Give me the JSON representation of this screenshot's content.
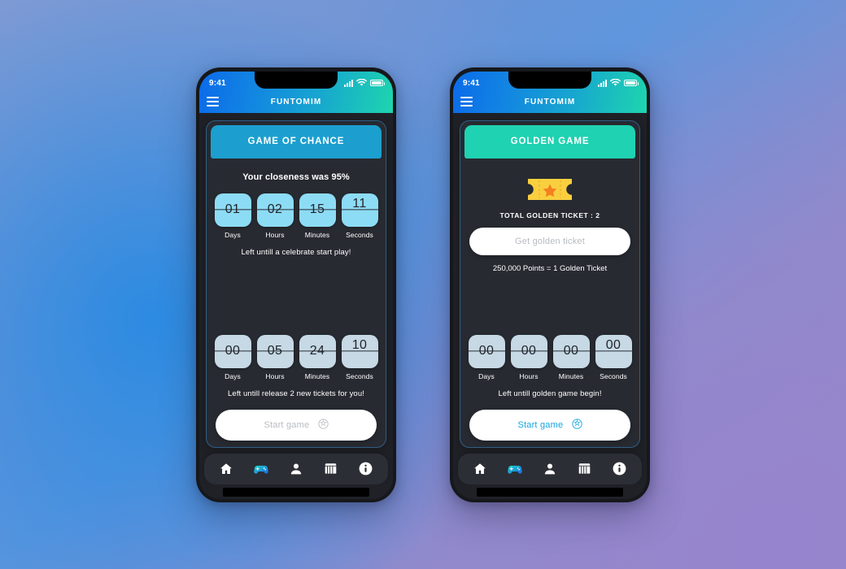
{
  "background": {
    "colors": [
      "#7f9ad3",
      "#3f8ddc",
      "#9a89c8"
    ]
  },
  "theme": {
    "header_gradient_from": "#0b6ae9",
    "header_gradient_to": "#1ed5ae",
    "card_border": "#2f5f86",
    "screen_bg": "#1f2127",
    "card_bg": "#272a31",
    "accent_blue": "#1c9fcf",
    "accent_teal": "#1fd2b1",
    "flip_bright": "#8ddcf5",
    "flip_pale": "#c6d9e5",
    "ticket_yellow": "#f9cf3f",
    "ticket_star": "#f5801f",
    "active_link": "#12a5e0"
  },
  "phones": [
    {
      "status_bar": {
        "time": "9:41",
        "signal_icon": "signal-bars-icon",
        "wifi_icon": "wifi-icon",
        "battery_icon": "battery-icon"
      },
      "app_bar": {
        "menu_icon": "hamburger-menu-icon",
        "title": "FUNTOMIM"
      },
      "card": {
        "header_label": "GAME OF CHANCE",
        "header_style": "blue",
        "headline": "Your closeness was 95%",
        "timer_primary": {
          "style": "bright",
          "units": [
            {
              "value": "01",
              "label": "Days",
              "flipping": false
            },
            {
              "value": "02",
              "label": "Hours",
              "flipping": false
            },
            {
              "value": "15",
              "label": "Minutes",
              "flipping": false
            },
            {
              "value": "11",
              "label": "Seconds",
              "flipping": true
            }
          ],
          "caption": "Left untill a celebrate start play!"
        },
        "timer_secondary": {
          "style": "pale",
          "units": [
            {
              "value": "00",
              "label": "Days",
              "flipping": false
            },
            {
              "value": "05",
              "label": "Hours",
              "flipping": false
            },
            {
              "value": "24",
              "label": "Minutes",
              "flipping": false
            },
            {
              "value": "10",
              "label": "Seconds",
              "flipping": true
            }
          ],
          "caption": "Left untill release 2 new tickets for you!"
        },
        "primary_button": {
          "label": "Start game",
          "icon": "soccer-ball-icon",
          "state": "muted"
        }
      },
      "bottom_nav": [
        {
          "name": "home-icon",
          "active": false
        },
        {
          "name": "gamepad-icon",
          "active": true
        },
        {
          "name": "person-icon",
          "active": false
        },
        {
          "name": "store-icon",
          "active": false
        },
        {
          "name": "info-icon",
          "active": false
        }
      ]
    },
    {
      "status_bar": {
        "time": "9:41",
        "signal_icon": "signal-bars-icon",
        "wifi_icon": "wifi-icon",
        "battery_icon": "battery-icon"
      },
      "app_bar": {
        "menu_icon": "hamburger-menu-icon",
        "title": "FUNTOMIM"
      },
      "card": {
        "header_label": "GOLDEN GAME",
        "header_style": "teal",
        "ticket_icon": "golden-ticket-icon",
        "ticket_total_label": "TOTAL GOLDEN TICKET : 2",
        "get_ticket_button": {
          "label": "Get golden ticket",
          "state": "muted"
        },
        "points_note": "250,000 Points = 1 Golden Ticket",
        "timer_primary": {
          "style": "pale",
          "units": [
            {
              "value": "00",
              "label": "Days",
              "flipping": false
            },
            {
              "value": "00",
              "label": "Hours",
              "flipping": false
            },
            {
              "value": "00",
              "label": "Minutes",
              "flipping": false
            },
            {
              "value": "00",
              "label": "Seconds",
              "flipping": true
            }
          ],
          "caption": "Left untill golden game begin!"
        },
        "primary_button": {
          "label": "Start game",
          "icon": "soccer-ball-icon",
          "state": "active"
        }
      },
      "bottom_nav": [
        {
          "name": "home-icon",
          "active": false
        },
        {
          "name": "gamepad-icon",
          "active": true
        },
        {
          "name": "person-icon",
          "active": false
        },
        {
          "name": "store-icon",
          "active": false
        },
        {
          "name": "info-icon",
          "active": false
        }
      ]
    }
  ]
}
